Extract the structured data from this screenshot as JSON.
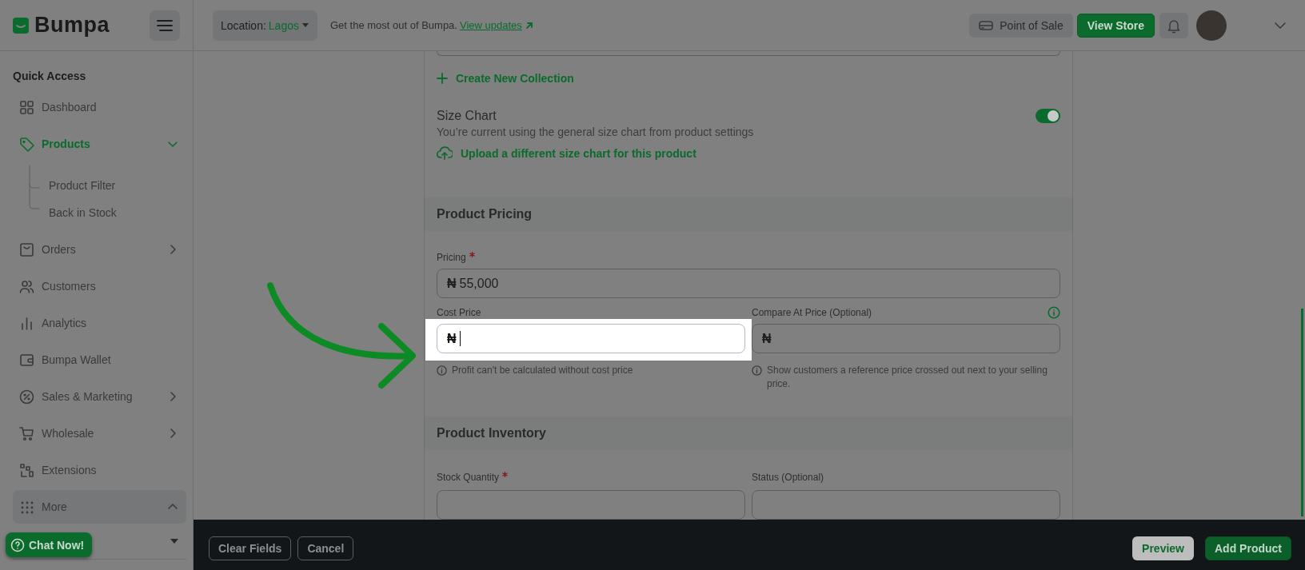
{
  "header": {
    "logo": "Bumpa",
    "location_label": "Location:",
    "location_value": "Lagos",
    "notice": "Get the most out of Bumpa.",
    "notice_link": "View updates",
    "pos_button": "Point of Sale",
    "view_store_button": "View Store"
  },
  "sidebar": {
    "section_title": "Quick Access",
    "items": [
      {
        "label": "Dashboard",
        "kind": "link",
        "selected": false
      },
      {
        "label": "Products",
        "kind": "group",
        "selected": true,
        "expanded": true,
        "children": [
          {
            "label": "Product Filter"
          },
          {
            "label": "Back in Stock"
          }
        ]
      },
      {
        "label": "Orders",
        "kind": "group",
        "selected": false,
        "expanded": false
      },
      {
        "label": "Customers",
        "kind": "link",
        "selected": false
      },
      {
        "label": "Analytics",
        "kind": "link",
        "selected": false
      },
      {
        "label": "Bumpa Wallet",
        "kind": "link",
        "selected": false
      },
      {
        "label": "Sales & Marketing",
        "kind": "group",
        "selected": false,
        "expanded": false
      },
      {
        "label": "Wholesale",
        "kind": "group",
        "selected": false,
        "expanded": false
      },
      {
        "label": "Extensions",
        "kind": "link",
        "selected": false
      },
      {
        "label": "More",
        "kind": "more",
        "selected": false,
        "expanded": true
      }
    ],
    "chat_button": "Chat Now!"
  },
  "form": {
    "collection_link": "Create New Collection",
    "size_chart": {
      "title": "Size Chart",
      "description": "You’re current using the general size chart from product settings",
      "on": true,
      "upload_link": "Upload a different size chart for this product"
    },
    "pricing": {
      "title": "Product Pricing",
      "fields": [
        {
          "label": "Pricing",
          "required": true,
          "currency": "₦",
          "value": "55,000",
          "focused": false
        },
        {
          "label": "Cost Price",
          "required": false,
          "currency": "₦",
          "focused": true,
          "hint": "Profit can't be calculated without cost price"
        },
        {
          "label": "Compare At Price (Optional)",
          "required": false,
          "currency": "₦",
          "focused": false,
          "info": true,
          "hint": "Show customers a reference price crossed out next to your selling price."
        }
      ]
    },
    "inventory": {
      "title": "Product Inventory",
      "fields": [
        {
          "label": "Stock Quantity",
          "required": true
        },
        {
          "label": "Status (Optional)",
          "required": false
        }
      ]
    }
  },
  "footer": {
    "buttons": [
      {
        "label": "Clear Fields",
        "kind": "outline"
      },
      {
        "label": "Cancel",
        "kind": "outline"
      },
      {
        "label": "Preview",
        "kind": "light"
      },
      {
        "label": "Add Product",
        "kind": "primary"
      }
    ]
  }
}
